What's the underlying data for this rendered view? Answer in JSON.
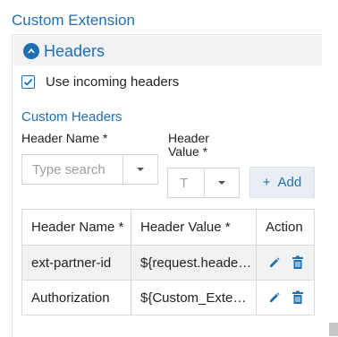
{
  "page": {
    "title": "Custom Extension"
  },
  "panel": {
    "header_label": "Headers",
    "use_incoming_headers": {
      "label": "Use incoming headers",
      "checked": true
    }
  },
  "custom_headers": {
    "section_title": "Custom Headers",
    "header_name_label": "Header Name *",
    "header_value_label_line1": "Header",
    "header_value_label_line2": "Value *",
    "header_name_placeholder": "Type search",
    "header_value_placeholder": "T",
    "add_button_label": "Add"
  },
  "table": {
    "columns": [
      "Header Name *",
      "Header Value *",
      "Action"
    ],
    "rows": [
      {
        "name": "ext-partner-id",
        "value": "${request.headers…"
      },
      {
        "name": "Authorization",
        "value": "${Custom_Extensi…"
      }
    ]
  },
  "colors": {
    "accent": "#1f6fb2",
    "header_bg": "#f1f2f3"
  },
  "icons": [
    "chevron-up-circle-icon",
    "check-icon",
    "plus-icon",
    "pencil-icon",
    "trash-icon",
    "caret-down-icon"
  ]
}
